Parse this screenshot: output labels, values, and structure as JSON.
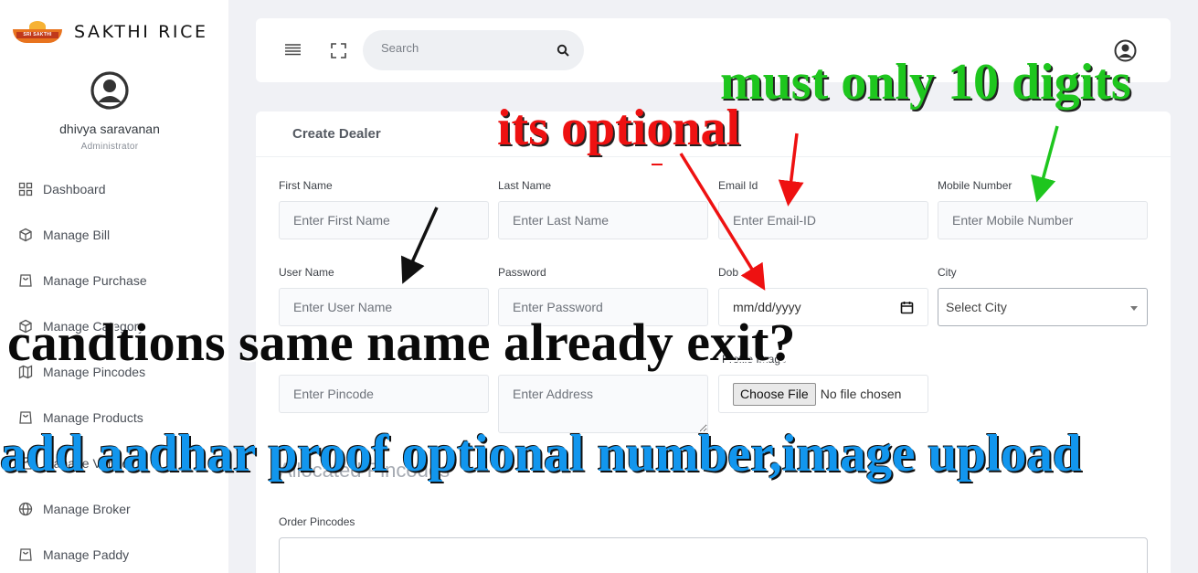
{
  "brand": {
    "name": "SAKTHI RICE",
    "logo_text": "SRI SAKTHI"
  },
  "profile": {
    "name": "dhivya saravanan",
    "role": "Administrator"
  },
  "nav": [
    {
      "label": "Dashboard",
      "icon": "grid-icon"
    },
    {
      "label": "Manage Bill",
      "icon": "box-icon"
    },
    {
      "label": "Manage Purchase",
      "icon": "bag-icon"
    },
    {
      "label": "Manage Category",
      "icon": "box-icon"
    },
    {
      "label": "Manage Pincodes",
      "icon": "map-icon"
    },
    {
      "label": "Manage Products",
      "icon": "bag-icon"
    },
    {
      "label": "Manage Vendor",
      "icon": "bag-icon"
    },
    {
      "label": "Manage Broker",
      "icon": "globe-icon"
    },
    {
      "label": "Manage Paddy",
      "icon": "bag-icon"
    }
  ],
  "topbar": {
    "search_placeholder": "Search"
  },
  "form": {
    "title": "Create Dealer",
    "first_name": {
      "label": "First Name",
      "placeholder": "Enter First Name"
    },
    "last_name": {
      "label": "Last Name",
      "placeholder": "Enter Last Name"
    },
    "email": {
      "label": "Email Id",
      "placeholder": "Enter Email-ID"
    },
    "mobile": {
      "label": "Mobile Number",
      "placeholder": "Enter Mobile Number"
    },
    "username": {
      "label": "User Name",
      "placeholder": "Enter User Name"
    },
    "password": {
      "label": "Password",
      "placeholder": "Enter Password"
    },
    "dob": {
      "label": "Dob",
      "value": "mm/dd/yyyy"
    },
    "city": {
      "label": "City",
      "value": "Select City"
    },
    "pincode": {
      "placeholder": "Enter Pincode"
    },
    "address": {
      "placeholder": "Enter Address"
    },
    "profile_image": {
      "label": "Profile Image",
      "button": "Choose File",
      "status": "No file chosen"
    },
    "allocated_title": "Allocated Pincodes",
    "order_pincodes_label": "Order Pincodes"
  },
  "annotations": {
    "green": "must only 10 digits",
    "red": "its optional",
    "black": "candtions same name already exit?",
    "blue": "add aadhar proof optional number,image upload"
  },
  "colors": {
    "accent_green": "#1ec61e",
    "accent_red": "#ee1111",
    "accent_blue": "#1296ee"
  }
}
